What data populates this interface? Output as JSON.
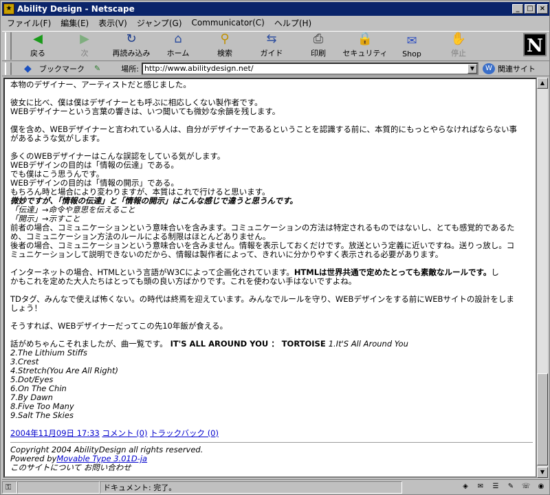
{
  "window": {
    "title": "Ability Design - Netscape"
  },
  "menu": [
    "ファイル(F)",
    "編集(E)",
    "表示(V)",
    "ジャンプ(G)",
    "Communicator(C)",
    "ヘルプ(H)"
  ],
  "toolbar": {
    "back": "戻る",
    "forward": "次",
    "reload": "再読み込み",
    "home": "ホーム",
    "search": "検索",
    "guide": "ガイド",
    "print": "印刷",
    "security": "セキュリティ",
    "shop": "Shop",
    "stop": "停止"
  },
  "location": {
    "bookmarks": "ブックマーク",
    "label": "場所:",
    "url": "http://www.abilitydesign.net/",
    "related": "関連サイト"
  },
  "article": {
    "lines": [
      "本物のデザイナー、アーティストだと感じました。",
      "",
      "彼女に比べ、僕は僕はデザイナーとも呼ぶに相応しくない製作者です。",
      "WEBデザイナーという言葉の響きは、いつ聞いても微妙な余韻を残します。",
      "",
      "僕を含め、WEBデザイナーと言われている人は、自分がデザイナーであるということを認識する前に、本質的にもっとやらなければならない事",
      "があるような気がします。",
      "",
      "多くのWEBデザイナーはこんな誤認をしている気がします。",
      "WEBデザインの目的は「情報の伝達」である。",
      "でも僕はこう思うんです。",
      "WEBデザインの目的は「情報の開示」である。",
      "もちろん時と場合により変わりますが、本質はこれで行けると思います。"
    ],
    "emph_line": "微妙ですが、「情報の伝達」と「情報の開示」はこんな感じで違うと思うんです。",
    "def1": "「伝達」→命令や意思を伝えること",
    "def2": "「開示」→示すこと",
    "para_a1": "前者の場合、コミュニケーションという意味合いを含みます。コミュニケーションの方法は特定されるものではないし、とても感覚的であるた",
    "para_a2": "め、コミュニケーション方法のルールによる制限はほとんどありません。",
    "para_b1": "後者の場合、コミュニケーションという意味合いを含みません。情報を表示しておくだけです。放送という定義に近いですね。送りっ放し。コ",
    "para_b2": "ミュニケーションして説明できないのだから、情報は製作者によって、きれいに分かりやすく表示される必要があります。",
    "html_pre": "インターネットの場合、HTMLという言語がW3Cによって企画化されています。",
    "html_bold": "HTMLは世界共通で定めたとっても素敵なルールです。",
    "html_post": "し",
    "html_line2": "かもこれを定めた大人たちはとっても頭の良い方ばかりです。これを使わない手はないですよね。",
    "td1": "TDタグ、みんなで使えば怖くない。の時代は終焉を迎えています。みんなでルールを守り、WEBデザインをする前にWEBサイトの設計をしま",
    "td2": "しょう！",
    "rice": "そうすれば、WEBデザイナーだってこの先10年飯が食える。",
    "track_pre": "話がめちゃんこそれましたが、曲一覧です。",
    "track_album": "IT'S ALL AROUND YOU ： TORTOISE",
    "tracks": [
      "1.It'S All Around You",
      "2.The Lithium Stiffs",
      "3.Crest",
      "4.Stretch(You Are All Right)",
      "5.Dot/Eyes",
      "6.On The Chin",
      "7.By Dawn",
      "8.Five Too Many",
      "9.Salt The Skies"
    ]
  },
  "meta": {
    "date": "2004年11月09日 17:33",
    "comment": "コメント (0)",
    "trackback": "トラックバック (0)"
  },
  "footer": {
    "copyright": "Copyright 2004 AbilityDesign all rights reserved.",
    "powered_pre": "Powered by",
    "powered_link": "Movable Type 3.01D-ja",
    "about": "このサイトについて",
    "contact": "お問い合わせ"
  },
  "status": {
    "text": "ドキュメント: 完了。"
  }
}
